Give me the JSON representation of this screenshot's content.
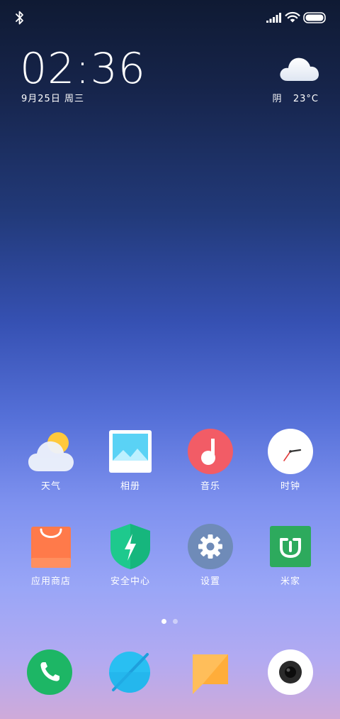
{
  "status_bar": {
    "icons": [
      "bluetooth-icon",
      "signal-icon",
      "wifi-icon",
      "battery-icon"
    ]
  },
  "clock": {
    "time": "02:36",
    "date": "9月25日 周三"
  },
  "weather": {
    "condition": "阴",
    "temperature": "23°C",
    "icon": "cloud-icon"
  },
  "apps": [
    {
      "label": "天气",
      "icon": "weather-icon"
    },
    {
      "label": "相册",
      "icon": "gallery-icon"
    },
    {
      "label": "音乐",
      "icon": "music-icon"
    },
    {
      "label": "时钟",
      "icon": "clock-icon"
    },
    {
      "label": "应用商店",
      "icon": "app-store-icon"
    },
    {
      "label": "安全中心",
      "icon": "security-icon"
    },
    {
      "label": "设置",
      "icon": "settings-icon"
    },
    {
      "label": "米家",
      "icon": "mijia-icon"
    }
  ],
  "dock": [
    {
      "icon": "phone-icon"
    },
    {
      "icon": "browser-icon"
    },
    {
      "icon": "messages-icon"
    },
    {
      "icon": "camera-icon"
    }
  ],
  "pager": {
    "current": 1,
    "total": 2
  },
  "colors": {
    "phone": "#1db665",
    "browser": "#29bff2",
    "messages": "#ffbe5a",
    "music": "#f25c66",
    "store": "#ff7a4a",
    "security": "#1ec98d",
    "settings": "#6f8bb8",
    "mijia": "#2daa5d"
  }
}
